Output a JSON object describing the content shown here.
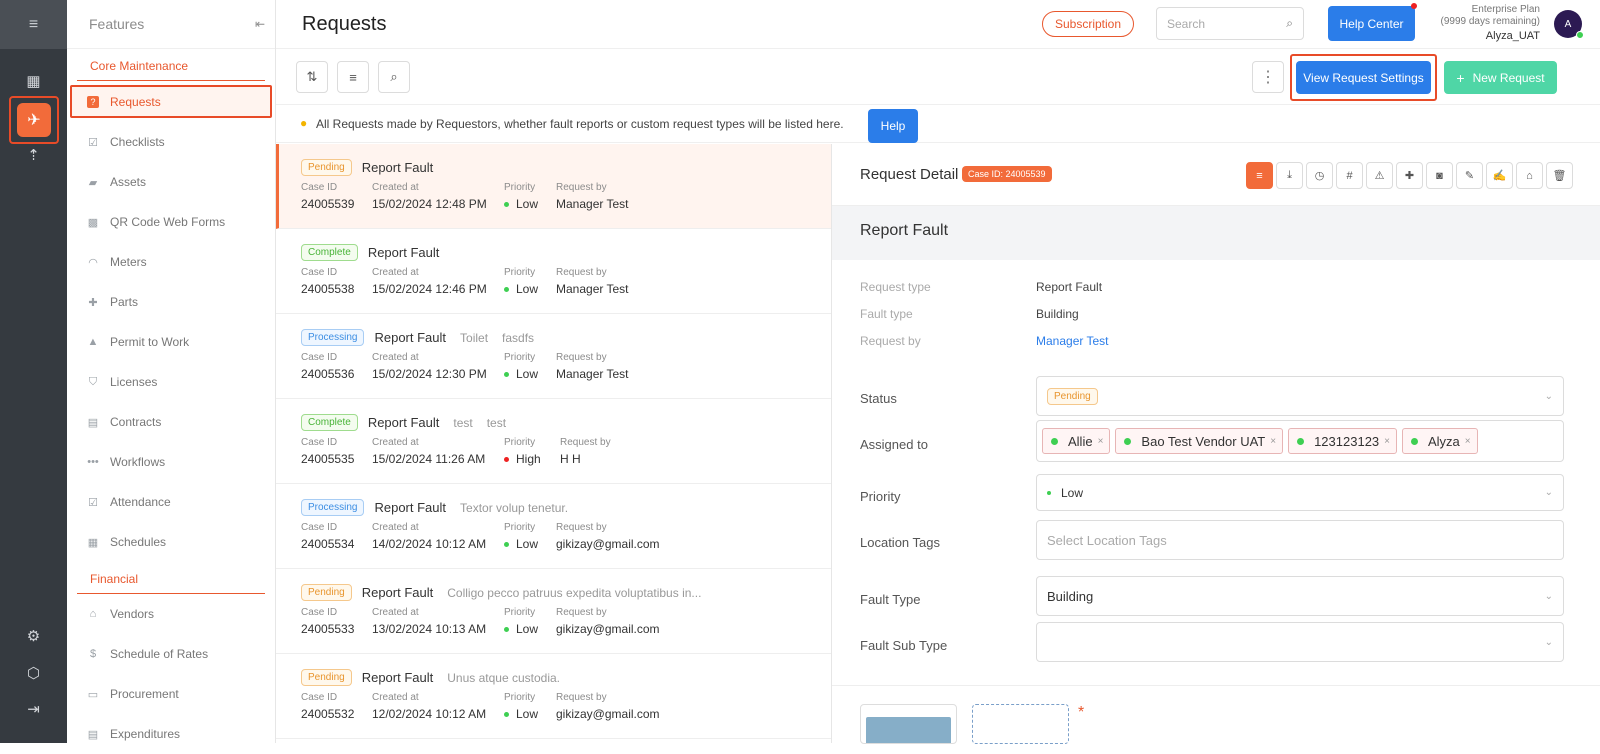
{
  "sidebar": {
    "header": "Features",
    "sections": [
      {
        "title": "Core Maintenance",
        "items": [
          "Requests",
          "Checklists",
          "Assets",
          "QR Code Web Forms",
          "Meters",
          "Parts",
          "Permit to Work",
          "Licenses",
          "Contracts",
          "Workflows",
          "Attendance",
          "Schedules"
        ]
      },
      {
        "title": "Financial",
        "items": [
          "Vendors",
          "Schedule of Rates",
          "Procurement",
          "Expenditures"
        ]
      }
    ]
  },
  "header": {
    "title": "Requests",
    "subscription": "Subscription",
    "search_placeholder": "Search",
    "help_center": "Help Center",
    "plan": "Enterprise Plan",
    "plan_remaining": "(9999 days remaining)",
    "user": "Alyza_UAT",
    "avatar_initial": "A"
  },
  "toolbar": {
    "view_settings": "View Request Settings",
    "new_request": "New Request"
  },
  "info": {
    "text": "All Requests made by Requestors, whether fault reports or custom request types will be listed here.",
    "help": "Help"
  },
  "list": {
    "labels": {
      "case": "Case ID",
      "created": "Created at",
      "priority": "Priority",
      "by": "Request by"
    },
    "rows": [
      {
        "status": "Pending",
        "title": "Report Fault",
        "extra1": "",
        "extra2": "",
        "case": "24005539",
        "created": "15/02/2024 12:48 PM",
        "priority": "Low",
        "by": "Manager Test"
      },
      {
        "status": "Complete",
        "title": "Report Fault",
        "extra1": "",
        "extra2": "",
        "case": "24005538",
        "created": "15/02/2024 12:46 PM",
        "priority": "Low",
        "by": "Manager Test"
      },
      {
        "status": "Processing",
        "title": "Report Fault",
        "extra1": "Toilet",
        "extra2": "fasdfs",
        "case": "24005536",
        "created": "15/02/2024 12:30 PM",
        "priority": "Low",
        "by": "Manager Test"
      },
      {
        "status": "Complete",
        "title": "Report Fault",
        "extra1": "test",
        "extra2": "test",
        "case": "24005535",
        "created": "15/02/2024 11:26 AM",
        "priority": "High",
        "by": "H H"
      },
      {
        "status": "Processing",
        "title": "Report Fault",
        "extra1": "Textor volup tenetur.",
        "extra2": "",
        "case": "24005534",
        "created": "14/02/2024 10:12 AM",
        "priority": "Low",
        "by": "gikizay@gmail.com"
      },
      {
        "status": "Pending",
        "title": "Report Fault",
        "extra1": "Colligo pecco patruus expedita voluptatibus in...",
        "extra2": "",
        "case": "24005533",
        "created": "13/02/2024 10:13 AM",
        "priority": "Low",
        "by": "gikizay@gmail.com"
      },
      {
        "status": "Pending",
        "title": "Report Fault",
        "extra1": "Unus atque custodia.",
        "extra2": "",
        "case": "24005532",
        "created": "12/02/2024 10:12 AM",
        "priority": "Low",
        "by": "gikizay@gmail.com"
      }
    ]
  },
  "detail": {
    "title": "Request Detail",
    "case_badge": "Case ID: 24005539",
    "heading": "Report Fault",
    "request_type_label": "Request type",
    "request_type": "Report Fault",
    "fault_type_label": "Fault type",
    "fault_type": "Building",
    "request_by_label": "Request by",
    "request_by": "Manager Test",
    "status_label": "Status",
    "status": "Pending",
    "assigned_label": "Assigned to",
    "assigned": [
      "Allie",
      "Bao Test Vendor UAT",
      "123123123",
      "Alyza"
    ],
    "priority_label": "Priority",
    "priority": "Low",
    "location_label": "Location Tags",
    "location_placeholder": "Select Location Tags",
    "fault_type_field_label": "Fault Type",
    "fault_type_field": "Building",
    "fault_sub_label": "Fault Sub Type",
    "fault_sub": ""
  },
  "colors": {
    "accent": "#f26b3a",
    "primary": "#2b7de9",
    "green": "#4fd6a6",
    "highlight_border": "#e84b28"
  }
}
